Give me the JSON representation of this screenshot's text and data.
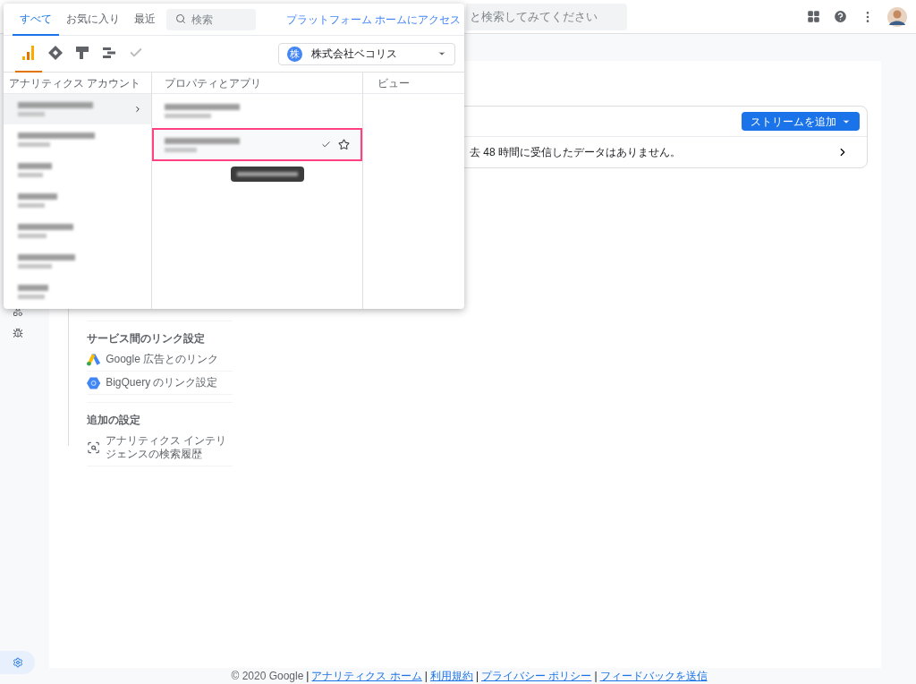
{
  "top_bar": {
    "search": {
      "placeholder": "と検索してみてください"
    }
  },
  "picker": {
    "tabs": [
      {
        "label": "すべて",
        "selected": true
      },
      {
        "label": "お気に入り",
        "selected": false
      },
      {
        "label": "最近",
        "selected": false
      }
    ],
    "search": {
      "placeholder": "検索"
    },
    "platform_link": "プラットフォーム ホームにアクセス",
    "products": [
      {
        "kind": "analytics",
        "selected": true
      },
      {
        "kind": "tagmanager",
        "selected": false
      },
      {
        "kind": "optimize",
        "selected": false
      },
      {
        "kind": "datastudio",
        "selected": false
      },
      {
        "kind": "surveys",
        "selected": false
      }
    ],
    "organization": {
      "badge": "株",
      "name": "株式会社ベコリス"
    },
    "columns": [
      "アナリティクス アカウント",
      "プロパティとアプリ",
      "ビュー"
    ],
    "accounts": [
      {
        "selected": true
      },
      {
        "selected": false
      },
      {
        "selected": false
      },
      {
        "selected": false
      },
      {
        "selected": false
      },
      {
        "selected": false
      },
      {
        "selected": false
      }
    ],
    "properties": [
      {
        "selected": false,
        "highlighted": false
      },
      {
        "selected": true,
        "highlighted": true
      }
    ]
  },
  "settings_menu": {
    "sections": [
      {
        "title": "サービス間のリンク設定",
        "items": [
          {
            "kind": "google-ads",
            "label": "Google 広告とのリンク"
          },
          {
            "kind": "bigquery",
            "label": "BigQuery のリンク設定"
          }
        ]
      },
      {
        "title": "追加の設定",
        "items": [
          {
            "kind": "search-history",
            "label": "アナリティクス インテリジェンスの検索履歴"
          }
        ]
      }
    ]
  },
  "stream_card": {
    "button": "ストリームを追加",
    "message": "去 48 時間に受信したデータはありません。"
  },
  "footer": [
    {
      "kind": "text",
      "text": "© 2020 Google"
    },
    {
      "kind": "separator",
      "text": "|"
    },
    {
      "kind": "link",
      "text": "アナリティクス ホーム"
    },
    {
      "kind": "separator",
      "text": "|"
    },
    {
      "kind": "link",
      "text": "利用規約"
    },
    {
      "kind": "separator",
      "text": "|"
    },
    {
      "kind": "link",
      "text": "プライバシー ポリシー"
    },
    {
      "kind": "separator",
      "text": "|"
    },
    {
      "kind": "link",
      "text": "フィードバックを送信"
    }
  ]
}
